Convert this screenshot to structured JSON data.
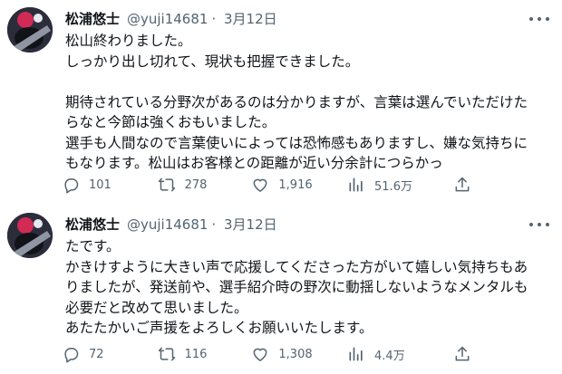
{
  "tweets": [
    {
      "display_name": "松浦悠士",
      "handle": "@yuji14681",
      "separator": "·",
      "date": "3月12日",
      "lines": [
        "松山終わりました。",
        "しっかり出し切れて、現状も把握できました。",
        "",
        "期待されている分野次があるのは分かりますが、言葉は選んでいただけた",
        "らなと今節は強くおもいました。",
        "選手も人間なので言葉使いによっては恐怖感もありますし、嫌な気持ちに",
        "もなります。松山はお客様との距離が近い分余計につらかっ"
      ],
      "replies": "101",
      "retweets": "278",
      "likes": "1,916",
      "views": "51.6万"
    },
    {
      "display_name": "松浦悠士",
      "handle": "@yuji14681",
      "separator": "·",
      "date": "3月12日",
      "lines": [
        "たです。",
        "かきけすように大きい声で応援してくださった方がいて嬉しい気持ちもあ",
        "りましたが、発送前や、選手紹介時の野次に動揺しないようなメンタルも",
        "必要だと改めて思いました。",
        "あたたかいご声援をよろしくお願いいたします。"
      ],
      "replies": "72",
      "retweets": "116",
      "likes": "1,308",
      "views": "4.4万"
    }
  ],
  "colors": {
    "text": "#0f1419",
    "secondary": "#536471",
    "background": "#ffffff"
  },
  "icons": [
    "reply-icon",
    "retweet-icon",
    "like-icon",
    "views-icon",
    "share-icon",
    "more-icon"
  ]
}
